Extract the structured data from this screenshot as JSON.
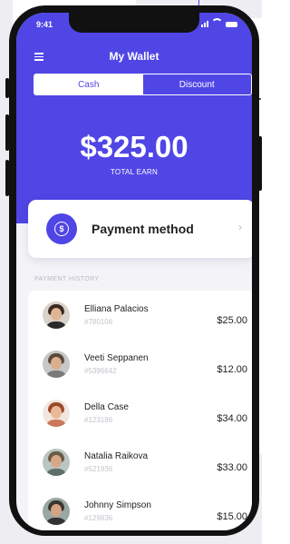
{
  "status_bar": {
    "time": "9:41"
  },
  "header": {
    "title": "My Wallet"
  },
  "tabs": [
    {
      "label": "Cash",
      "active": true
    },
    {
      "label": "Discount",
      "active": false
    }
  ],
  "balance": {
    "amount": "$325.00",
    "label": "TOTAL EARN"
  },
  "payment_method": {
    "label": "Payment method",
    "icon": "dollar-coin-icon"
  },
  "history": {
    "label": "PAYMENT HISTORY",
    "items": [
      {
        "name": "Elliana Palacios",
        "id": "#780106",
        "amount": "$25.00"
      },
      {
        "name": "Veeti Seppanen",
        "id": "#5396642",
        "amount": "$12.00"
      },
      {
        "name": "Della Case",
        "id": "#123186",
        "amount": "$34.00"
      },
      {
        "name": "Natalia Raikova",
        "id": "#521936",
        "amount": "$33.00"
      },
      {
        "name": "Johnny Simpson",
        "id": "#129836",
        "amount": "$15.00"
      }
    ]
  },
  "colors": {
    "accent": "#5046e6",
    "background": "#f4f4f8"
  }
}
